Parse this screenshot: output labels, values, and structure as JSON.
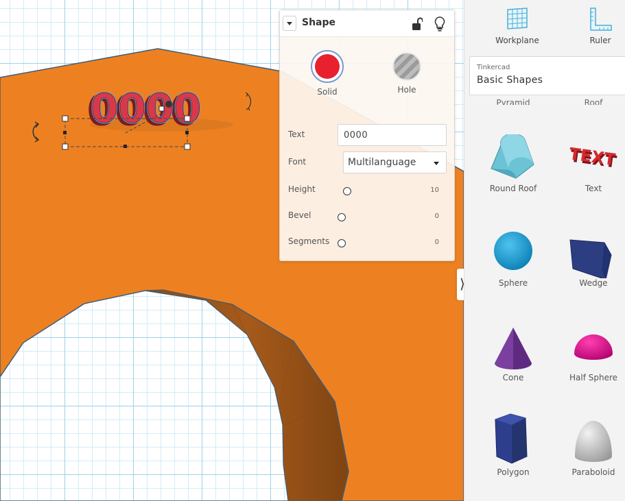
{
  "inspector": {
    "title": "Shape",
    "solid_label": "Solid",
    "hole_label": "Hole",
    "text_label": "Text",
    "text_value": "0000",
    "font_label": "Font",
    "font_value": "Multilanguage",
    "height_label": "Height",
    "height_value": "10",
    "bevel_label": "Bevel",
    "bevel_value": "0",
    "segments_label": "Segments",
    "segments_value": "0"
  },
  "canvas": {
    "text_object": "0000"
  },
  "sidebar": {
    "workplane_label": "Workplane",
    "ruler_label": "Ruler",
    "library_provider": "Tinkercad",
    "library_name": "Basic Shapes",
    "cut_labels": [
      "Pyramid",
      "Roof"
    ],
    "shapes": [
      {
        "label": "Round Roof",
        "icon": "round-roof-icon"
      },
      {
        "label": "Text",
        "icon": "text-shape-icon"
      },
      {
        "label": "Sphere",
        "icon": "sphere-icon"
      },
      {
        "label": "Wedge",
        "icon": "wedge-icon"
      },
      {
        "label": "Cone",
        "icon": "cone-icon"
      },
      {
        "label": "Half Sphere",
        "icon": "half-sphere-icon"
      },
      {
        "label": "Polygon",
        "icon": "polygon-icon"
      },
      {
        "label": "Paraboloid",
        "icon": "paraboloid-icon"
      }
    ]
  },
  "colors": {
    "orange_shape": "#ed8122",
    "ring_side": "#a55a19",
    "text_red": "#cc2b3b",
    "solid_red": "#e8212f",
    "selection_cyan": "#3bbde8"
  }
}
